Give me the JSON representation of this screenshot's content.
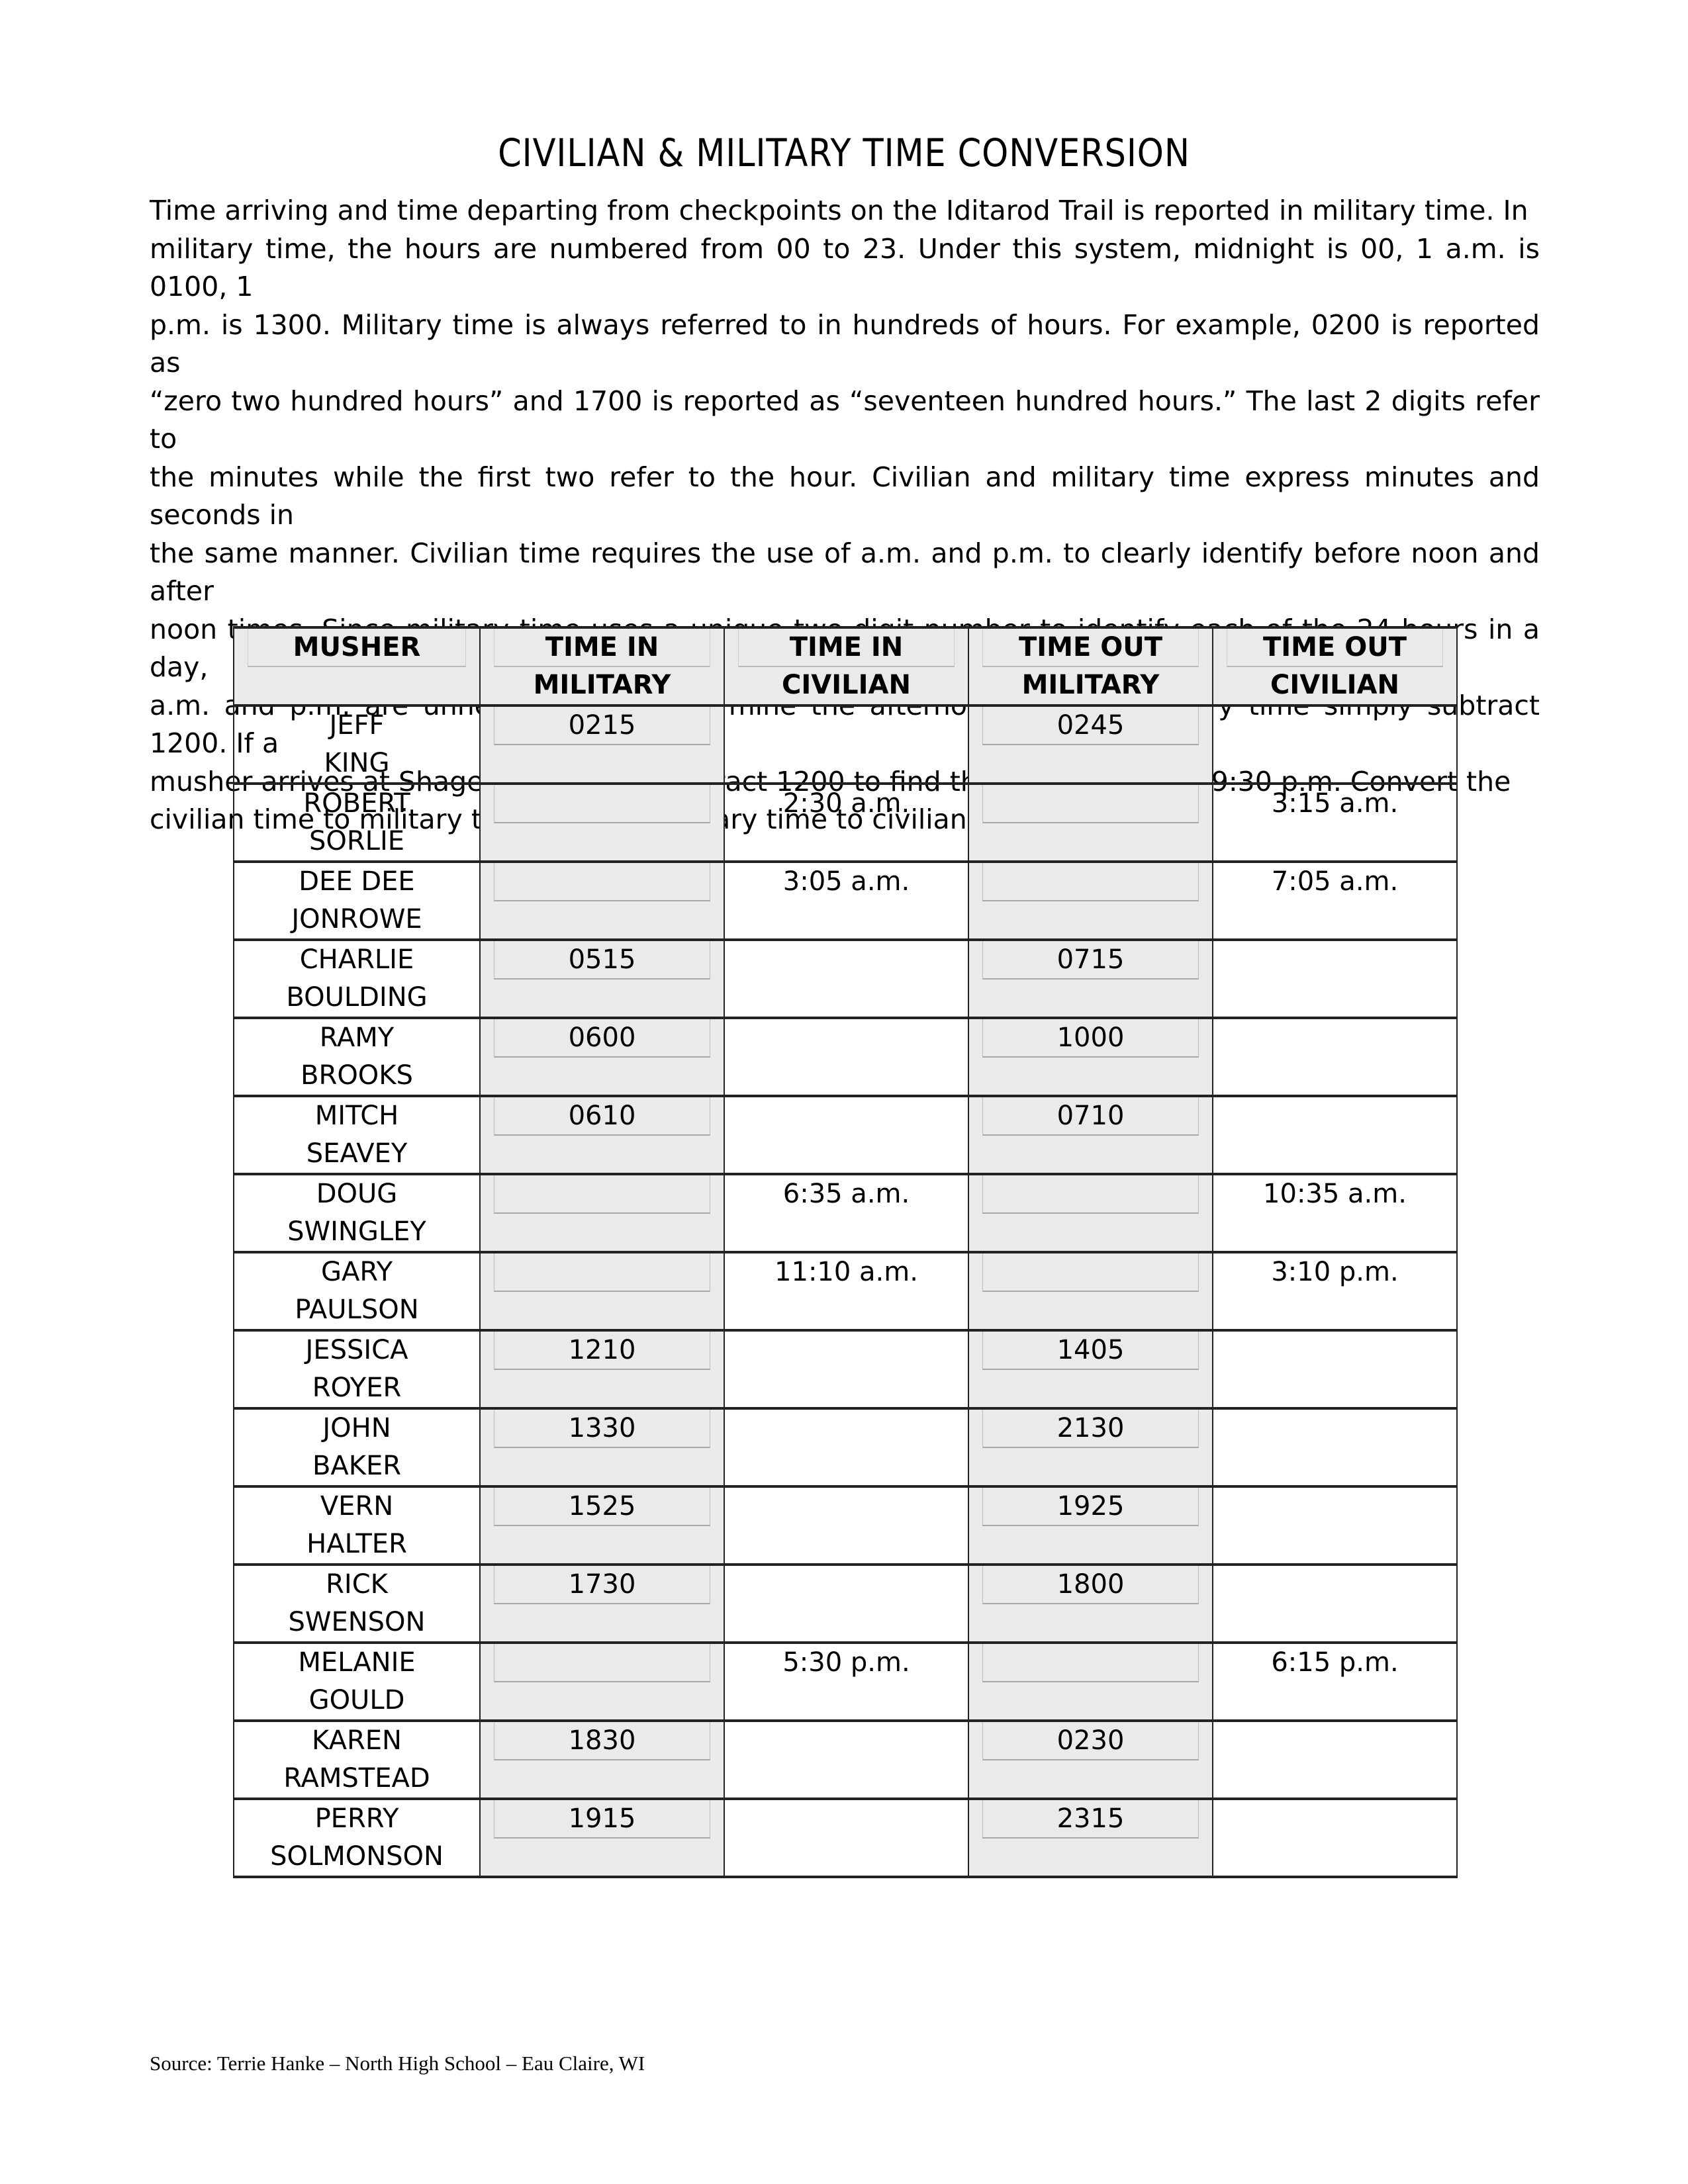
{
  "document": {
    "title": "CIVILIAN & MILITARY TIME CONVERSION",
    "intro_lines": [
      "Time arriving and time departing from checkpoints on the Iditarod Trail is reported in military time. In",
      "military time, the hours are numbered from 00 to 23.  Under this system, midnight is 00, 1 a.m. is 0100, 1",
      "p.m. is 1300.  Military time is always referred to in hundreds of hours.  For example, 0200 is reported as",
      "“zero two hundred hours” and 1700 is reported as “seventeen hundred hours.”   The last 2 digits refer to",
      "the minutes while the first two refer to the hour.  Civilian and military time express minutes and seconds in",
      "the same manner.  Civilian time requires the use of a.m. and p.m. to clearly identify before noon and after",
      "noon times.  Since military time uses a unique two-digit number to identify each of the 24 hours in a day,",
      "a.m. and p.m. are unnecessary. To determine the afternoon hour in military time simply subtract 1200.  If a",
      "musher arrives at Shageluk at 2130, subtract 1200 to find the civilian time of 9:30 p.m.  Convert the",
      "civilian time to military time and the military time to civilian for each musher."
    ],
    "source": "Source:  Terrie Hanke – North High School – Eau Claire, WI"
  },
  "table": {
    "headers": [
      {
        "line1": "MUSHER",
        "line2": ""
      },
      {
        "line1": "TIME IN",
        "line2": "MILITARY"
      },
      {
        "line1": "TIME IN",
        "line2": "CIVILIAN"
      },
      {
        "line1": "TIME OUT",
        "line2": "MILITARY"
      },
      {
        "line1": "TIME OUT",
        "line2": "CIVILIAN"
      }
    ],
    "rows": [
      {
        "first": "JEFF",
        "last": "KING",
        "in_military": "0215",
        "in_civilian": "",
        "out_military": "0245",
        "out_civilian": ""
      },
      {
        "first": "ROBERT",
        "last": "SORLIE",
        "in_military": "",
        "in_civilian": "2:30 a.m.",
        "out_military": "",
        "out_civilian": "3:15 a.m."
      },
      {
        "first": "DEE DEE",
        "last": "JONROWE",
        "in_military": "",
        "in_civilian": "3:05 a.m.",
        "out_military": "",
        "out_civilian": "7:05 a.m."
      },
      {
        "first": "CHARLIE",
        "last": "BOULDING",
        "in_military": "0515",
        "in_civilian": "",
        "out_military": "0715",
        "out_civilian": ""
      },
      {
        "first": "RAMY",
        "last": "BROOKS",
        "in_military": "0600",
        "in_civilian": "",
        "out_military": "1000",
        "out_civilian": ""
      },
      {
        "first": "MITCH",
        "last": "SEAVEY",
        "in_military": "0610",
        "in_civilian": "",
        "out_military": "0710",
        "out_civilian": ""
      },
      {
        "first": "DOUG",
        "last": "SWINGLEY",
        "in_military": "",
        "in_civilian": "6:35 a.m.",
        "out_military": "",
        "out_civilian": "10:35 a.m."
      },
      {
        "first": "GARY",
        "last": "PAULSON",
        "in_military": "",
        "in_civilian": "11:10 a.m.",
        "out_military": "",
        "out_civilian": "3:10 p.m."
      },
      {
        "first": "JESSICA",
        "last": "ROYER",
        "in_military": "1210",
        "in_civilian": "",
        "out_military": "1405",
        "out_civilian": ""
      },
      {
        "first": "JOHN",
        "last": "BAKER",
        "in_military": "1330",
        "in_civilian": "",
        "out_military": "2130",
        "out_civilian": ""
      },
      {
        "first": "VERN",
        "last": "HALTER",
        "in_military": "1525",
        "in_civilian": "",
        "out_military": "1925",
        "out_civilian": ""
      },
      {
        "first": "RICK",
        "last": "SWENSON",
        "in_military": "1730",
        "in_civilian": "",
        "out_military": "1800",
        "out_civilian": ""
      },
      {
        "first": "MELANIE",
        "last": "GOULD",
        "in_military": "",
        "in_civilian": "5:30 p.m.",
        "out_military": "",
        "out_civilian": "6:15 p.m."
      },
      {
        "first": "KAREN",
        "last": "RAMSTEAD",
        "in_military": "1830",
        "in_civilian": "",
        "out_military": "0230",
        "out_civilian": ""
      },
      {
        "first": "PERRY",
        "last": "SOLMONSON",
        "in_military": "1915",
        "in_civilian": "",
        "out_military": "2315",
        "out_civilian": ""
      }
    ]
  },
  "colors": {
    "shaded_cell": "#eaeaea",
    "grid_line": "#222222"
  }
}
